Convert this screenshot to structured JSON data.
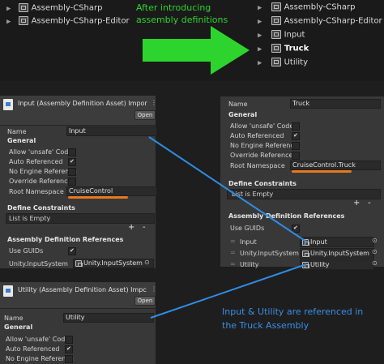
{
  "project_tree_before": {
    "items": [
      {
        "label": "Assembly-CSharp"
      },
      {
        "label": "Assembly-CSharp-Editor"
      }
    ]
  },
  "project_tree_after": {
    "items": [
      {
        "label": "Assembly-CSharp",
        "bold": false
      },
      {
        "label": "Assembly-CSharp-Editor",
        "bold": false
      },
      {
        "label": "Input",
        "bold": false
      },
      {
        "label": "Truck",
        "bold": true
      },
      {
        "label": "Utility",
        "bold": false
      }
    ]
  },
  "arrow_caption": {
    "line1": "After introducing",
    "line2": "assembly definitions"
  },
  "input_inspector": {
    "title": "Input (Assembly Definition Asset) Impor",
    "open_label": "Open",
    "name_label": "Name",
    "name_value": "Input",
    "general_label": "General",
    "allow_unsafe_label": "Allow 'unsafe' Code",
    "auto_referenced_label": "Auto Referenced",
    "no_engine_reference_label": "No Engine Reference",
    "override_references_label": "Override References",
    "root_namespace_label": "Root Namespace",
    "root_namespace_value": "CruiseControl",
    "define_constraints_label": "Define Constraints",
    "list_empty": "List is Empty",
    "plus": "+",
    "minus": "-",
    "asm_refs_label": "Assembly Definition References",
    "use_guids_label": "Use GUIDs",
    "ref_name": "Unity.InputSystem",
    "ref_value": "Unity.InputSystem"
  },
  "truck_inspector": {
    "name_label": "Name",
    "name_value": "Truck",
    "general_label": "General",
    "allow_unsafe_label": "Allow 'unsafe' Code",
    "auto_referenced_label": "Auto Referenced",
    "no_engine_reference_label": "No Engine Reference",
    "override_references_label": "Override References",
    "root_namespace_label": "Root Namespace",
    "root_namespace_value": "CruiseControl.Truck",
    "define_constraints_label": "Define Constraints",
    "list_empty": "List is Empty",
    "plus": "+",
    "minus": "-",
    "asm_refs_label": "Assembly Definition References",
    "use_guids_label": "Use GUIDs",
    "refs": [
      {
        "name": "Input",
        "value": "Input"
      },
      {
        "name": "Unity.InputSystem",
        "value": "Unity.InputSystem"
      },
      {
        "name": "Utility",
        "value": "Utility"
      }
    ]
  },
  "utility_inspector": {
    "title": "Utility (Assembly Definition Asset) Impc",
    "open_label": "Open",
    "name_label": "Name",
    "name_value": "Utility",
    "general_label": "General",
    "allow_unsafe_label": "Allow 'unsafe' Code",
    "auto_referenced_label": "Auto Referenced",
    "no_engine_reference_label": "No Engine Reference"
  },
  "annotation": {
    "line1": "Input & Utility are referenced in",
    "line2": "the Truck Assembly"
  },
  "colors": {
    "arrow": "#2ed42e",
    "annotation_text": "#3a8fe8",
    "connector": "#2f8de4",
    "underline": "#e8781e"
  }
}
